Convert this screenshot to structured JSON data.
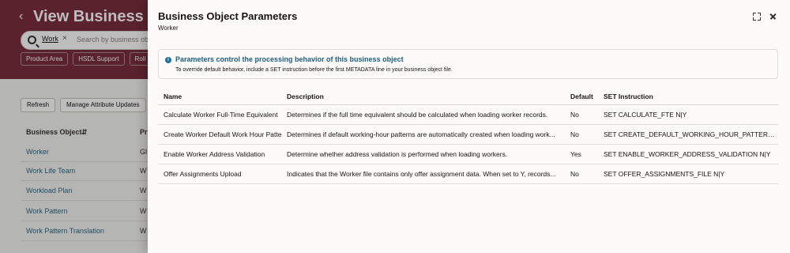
{
  "background": {
    "page_title": "View Business Object",
    "back_icon": "chevron-left-icon",
    "search": {
      "chip": "Work",
      "placeholder": "Search by business obje"
    },
    "filters": [
      "Product Area",
      "HSDL Support",
      "Roll Back Sup"
    ],
    "toolbar": {
      "refresh": "Refresh",
      "manage": "Manage Attribute Updates"
    },
    "columns": {
      "business_object": "Business Object",
      "product": "Pr"
    },
    "rows": [
      {
        "name": "Worker",
        "product": "Gl"
      },
      {
        "name": "Work Life Team",
        "product": "W"
      },
      {
        "name": "Workload Plan",
        "product": "W"
      },
      {
        "name": "Work Pattern",
        "product": "W"
      },
      {
        "name": "Work Pattern Translation",
        "product": "W"
      }
    ]
  },
  "drawer": {
    "title": "Business Object Parameters",
    "subtitle": "Worker",
    "info": {
      "title": "Parameters control the processing behavior of this business object",
      "text": "To override default behavior, include a SET instruction before the first METADATA line in your business object file."
    },
    "table": {
      "headers": {
        "name": "Name",
        "description": "Description",
        "default": "Default",
        "set": "SET Instruction"
      },
      "rows": [
        {
          "name": "Calculate Worker Full-Time Equivalent",
          "description": "Determines if the full time equivalent should be calculated when loading worker records.",
          "default": "No",
          "set": "SET CALCULATE_FTE N|Y"
        },
        {
          "name": "Create Worker Default Work Hour Patter",
          "description": "Determines if default working-hour patterns are automatically created when loading work...",
          "default": "No",
          "set": "SET CREATE_DEFAULT_WORKING_HOUR_PATTERN N|Y"
        },
        {
          "name": "Enable Worker Address Validation",
          "description": "Determine whether address validation is performed when loading workers.",
          "default": "Yes",
          "set": "SET ENABLE_WORKER_ADDRESS_VALIDATION N|Y"
        },
        {
          "name": "Offer Assignments Upload",
          "description": "Indicates that the Worker file contains only offer assignment data. When set to Y, records...",
          "default": "No",
          "set": "SET OFFER_ASSIGNMENTS_FILE N|Y"
        }
      ]
    }
  },
  "colors": {
    "banner": "#7a2e3d",
    "link": "#2d6a8a",
    "info_accent": "#1d6fa3"
  }
}
